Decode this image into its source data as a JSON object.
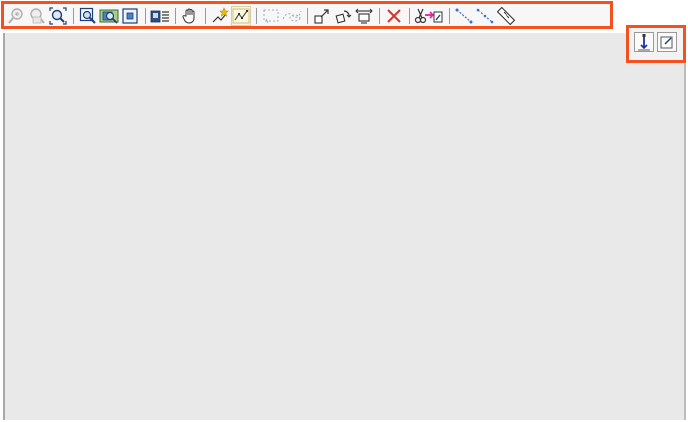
{
  "toolbar": {
    "groups": [
      [
        "zoom-in-icon",
        "zoom-out-icon",
        "zoom-extents-icon"
      ],
      [
        "zoom-window-icon",
        "zoom-previous-icon",
        "zoom-layer-icon"
      ],
      [
        "layer-properties-icon"
      ],
      [
        "pan-hand-icon"
      ],
      [
        "add-point-icon",
        "edit-vertices-icon"
      ],
      [
        "select-rectangle-icon",
        "select-polygon-icon"
      ],
      [
        "move-feature-icon",
        "rotate-feature-icon",
        "scale-feature-icon"
      ],
      [
        "delete-icon"
      ],
      [
        "cut-paste-icon"
      ],
      [
        "measure-line-icon",
        "measure-path-icon",
        "ruler-icon"
      ]
    ],
    "active_item": "edit-vertices-icon"
  },
  "mini_toolbar": {
    "items": [
      "arrange-vertical-icon",
      "edit-note-icon"
    ]
  },
  "colors": {
    "highlight": "#f4511e",
    "map_background": "#e9e9e9"
  }
}
